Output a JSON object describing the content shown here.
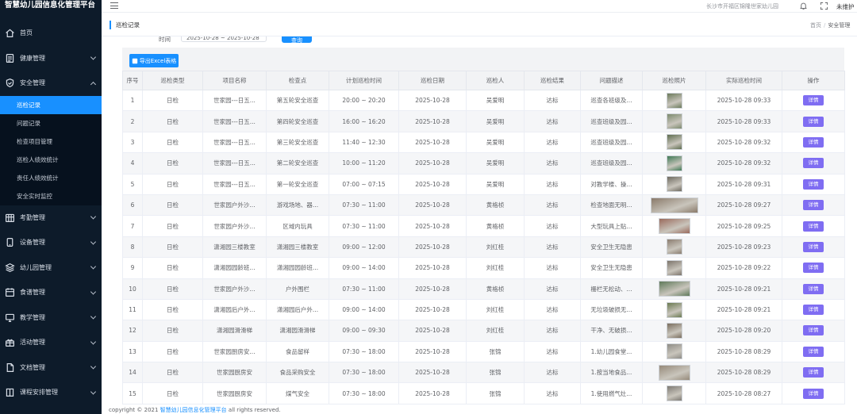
{
  "app": {
    "title": "智慧幼儿园信息化管理平台"
  },
  "sidebar": {
    "items": [
      {
        "label": "首页",
        "icon": "home-icon",
        "expanded": false,
        "has_children": false
      },
      {
        "label": "健康管理",
        "icon": "document-icon",
        "expanded": false,
        "has_children": true
      },
      {
        "label": "安全管理",
        "icon": "shield-icon",
        "expanded": true,
        "has_children": true
      },
      {
        "label": "考勤管理",
        "icon": "calendar-grid-icon",
        "expanded": false,
        "has_children": true
      },
      {
        "label": "设备管理",
        "icon": "tablet-icon",
        "expanded": false,
        "has_children": true
      },
      {
        "label": "幼儿园管理",
        "icon": "layers-icon",
        "expanded": false,
        "has_children": true
      },
      {
        "label": "食谱管理",
        "icon": "calendar-icon",
        "expanded": false,
        "has_children": true
      },
      {
        "label": "教学管理",
        "icon": "monitor-icon",
        "expanded": false,
        "has_children": true
      },
      {
        "label": "活动管理",
        "icon": "gift-icon",
        "expanded": false,
        "has_children": true
      },
      {
        "label": "文档管理",
        "icon": "file-icon",
        "expanded": false,
        "has_children": true
      },
      {
        "label": "课程安排管理",
        "icon": "book-icon",
        "expanded": false,
        "has_children": true
      }
    ],
    "submenu": [
      {
        "label": "巡检记录",
        "active": true
      },
      {
        "label": "问题记录",
        "active": false
      },
      {
        "label": "检查项目管理",
        "active": false
      },
      {
        "label": "巡检人绩效统计",
        "active": false
      },
      {
        "label": "责任人绩效统计",
        "active": false
      },
      {
        "label": "安全实时监控",
        "active": false
      }
    ]
  },
  "header": {
    "location": "长沙市开福区锦隆世家幼儿园",
    "user": "未维护"
  },
  "tabs": {
    "active": "巡检记录"
  },
  "breadcrumb": {
    "home": "首页",
    "current": "安全管理"
  },
  "filter": {
    "label": "时间",
    "date_range": "2025-10-28 ~ 2025-10-28",
    "query_label": "查询"
  },
  "toolbar": {
    "export_label": "导出Excel表格"
  },
  "table": {
    "columns": [
      "序号",
      "巡检类型",
      "项目名称",
      "检查点",
      "计划巡检时间",
      "巡检日期",
      "巡检人",
      "巡检结果",
      "问题描述",
      "巡检照片",
      "实际巡检时间",
      "操作"
    ],
    "action_label": "详情",
    "rows": [
      {
        "no": "1",
        "type": "日检",
        "project": "世家园---日五...",
        "point": "第五轮安全巡查",
        "plan": "20:00 ~ 20:20",
        "date": "2025-10-28",
        "inspector": "吴爱明",
        "result": "达标",
        "desc": "巡查各班级及...",
        "photo": {
          "w": 20,
          "color": "#6b7a5a"
        },
        "actual": "2025-10-28 09:33"
      },
      {
        "no": "2",
        "type": "日检",
        "project": "世家园---日五...",
        "point": "第四轮安全巡查",
        "plan": "16:00 ~ 16:20",
        "date": "2025-10-28",
        "inspector": "吴爱明",
        "result": "达标",
        "desc": "巡查班级及园...",
        "photo": {
          "w": 20,
          "color": "#7c8a6e"
        },
        "actual": "2025-10-28 09:33"
      },
      {
        "no": "3",
        "type": "日检",
        "project": "世家园---日五...",
        "point": "第三轮安全巡查",
        "plan": "11:40 ~ 12:30",
        "date": "2025-10-28",
        "inspector": "吴爱明",
        "result": "达标",
        "desc": "巡查班级及园...",
        "photo": {
          "w": 20,
          "color": "#5e6d4f"
        },
        "actual": "2025-10-28 09:32"
      },
      {
        "no": "4",
        "type": "日检",
        "project": "世家园---日五...",
        "point": "第二轮安全巡查",
        "plan": "10:00 ~ 11:20",
        "date": "2025-10-28",
        "inspector": "吴爱明",
        "result": "达标",
        "desc": "巡查班级及园...",
        "photo": {
          "w": 20,
          "color": "#3f7a55"
        },
        "actual": "2025-10-28 09:32"
      },
      {
        "no": "5",
        "type": "日检",
        "project": "世家园---日五...",
        "point": "第一轮安全巡查",
        "plan": "07:00 ~ 07:15",
        "date": "2025-10-28",
        "inspector": "吴爱明",
        "result": "达标",
        "desc": "对教学楼、操...",
        "photo": {
          "w": 20,
          "color": "#6e6a60"
        },
        "actual": "2025-10-28 09:31"
      },
      {
        "no": "6",
        "type": "日检",
        "project": "世家园户外沙...",
        "point": "游戏场地、器...",
        "plan": "07:30 ~ 11:00",
        "date": "2025-10-28",
        "inspector": "黄格桢",
        "result": "达标",
        "desc": "检查地面无明...",
        "photo": {
          "w": 60,
          "color": "#8a7a6a"
        },
        "actual": "2025-10-28 09:27"
      },
      {
        "no": "7",
        "type": "日检",
        "project": "世家园户外沙...",
        "point": "区域内玩具",
        "plan": "07:30 ~ 11:00",
        "date": "2025-10-28",
        "inspector": "黄格桢",
        "result": "达标",
        "desc": "大型玩具上贴...",
        "photo": {
          "w": 40,
          "color": "#9a6a5c"
        },
        "actual": "2025-10-28 09:25"
      },
      {
        "no": "8",
        "type": "日检",
        "project": "潇湘园三楼教室",
        "point": "潇湘园三楼教室",
        "plan": "09:00 ~ 12:00",
        "date": "2025-10-28",
        "inspector": "刘红桂",
        "result": "达标",
        "desc": "安全卫生无隐患",
        "photo": {
          "w": 20,
          "color": "#8b7d70"
        },
        "actual": "2025-10-28 09:23"
      },
      {
        "no": "9",
        "type": "日检",
        "project": "潇湘园园龄班...",
        "point": "潇湘园园龄班...",
        "plan": "09:00 ~ 14:00",
        "date": "2025-10-28",
        "inspector": "刘红桂",
        "result": "达标",
        "desc": "安全卫生无隐患",
        "photo": {
          "w": 20,
          "color": "#7d756c"
        },
        "actual": "2025-10-28 09:22"
      },
      {
        "no": "10",
        "type": "日检",
        "project": "世家园户外沙...",
        "point": "户外围栏",
        "plan": "07:30 ~ 11:00",
        "date": "2025-10-28",
        "inspector": "黄格桢",
        "result": "达标",
        "desc": "栅栏无松动、...",
        "photo": {
          "w": 40,
          "color": "#5f7a5a"
        },
        "actual": "2025-10-28 09:21"
      },
      {
        "no": "11",
        "type": "日检",
        "project": "潇湘园后户外...",
        "point": "潇湘园后户外...",
        "plan": "09:00 ~ 14:00",
        "date": "2025-10-28",
        "inspector": "刘红桂",
        "result": "达标",
        "desc": "无垃圾破损无...",
        "photo": {
          "w": 20,
          "color": "#6a7a50"
        },
        "actual": "2025-10-28 09:21"
      },
      {
        "no": "12",
        "type": "日检",
        "project": "潇湘园滑滑梯",
        "point": "潇湘园滑滑梯",
        "plan": "09:00 ~ 09:30",
        "date": "2025-10-28",
        "inspector": "刘红桂",
        "result": "达标",
        "desc": "干净、无破损...",
        "photo": {
          "w": 20,
          "color": "#7a6e5e"
        },
        "actual": "2025-10-28 09:20"
      },
      {
        "no": "13",
        "type": "日检",
        "project": "世家园厨房安...",
        "point": "食品留样",
        "plan": "07:30 ~ 18:00",
        "date": "2025-10-28",
        "inspector": "张锦",
        "result": "达标",
        "desc": "1.幼儿园食堂...",
        "photo": {
          "w": 20,
          "color": "#8e8c86"
        },
        "actual": "2025-10-28 08:29"
      },
      {
        "no": "14",
        "type": "日检",
        "project": "世家园厨房安",
        "point": "食品采购安全",
        "plan": "07:30 ~ 18:00",
        "date": "2025-10-28",
        "inspector": "张锦",
        "result": "达标",
        "desc": "1.按当地食品...",
        "photo": {
          "w": 40,
          "color": "#968a7a"
        },
        "actual": "2025-10-28 08:29"
      },
      {
        "no": "15",
        "type": "日检",
        "project": "世家园厨房安",
        "point": "煤气安全",
        "plan": "07:30 ~ 18:00",
        "date": "2025-10-28",
        "inspector": "张锦",
        "result": "达标",
        "desc": "1.使用燃气灶...",
        "photo": {
          "w": 20,
          "color": "#7e7a74"
        },
        "actual": "2025-10-28 08:27"
      }
    ]
  },
  "footer": {
    "prefix": "copyright © 2021",
    "link": "智慧幼儿园信息化管理平台",
    "suffix": "all rights reserved."
  }
}
